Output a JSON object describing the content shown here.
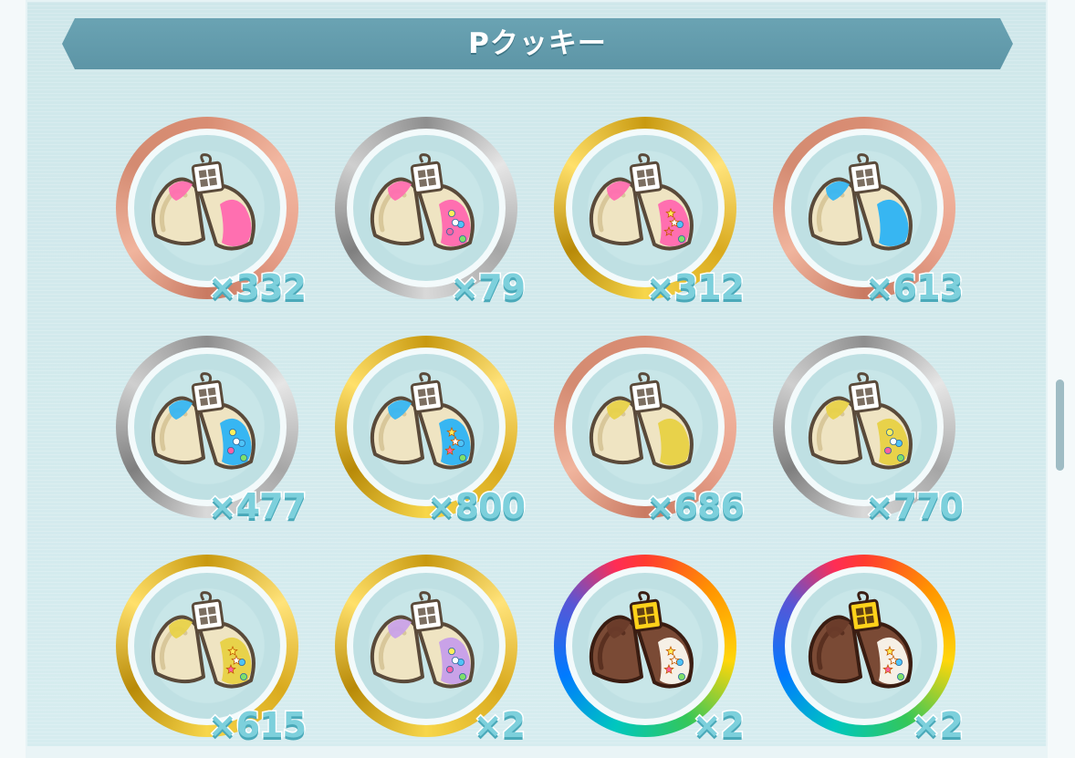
{
  "header": {
    "title": "Pクッキー"
  },
  "items": [
    {
      "count": "×332",
      "ring": "bronze",
      "cookie": "pink",
      "accent": "#ff6fb0"
    },
    {
      "count": "×79",
      "ring": "silver",
      "cookie": "pink-dots",
      "accent": "#ff6fb0"
    },
    {
      "count": "×312",
      "ring": "gold",
      "cookie": "pink-stars",
      "accent": "#ff6fb0"
    },
    {
      "count": "×613",
      "ring": "bronze",
      "cookie": "blue",
      "accent": "#37b6f2"
    },
    {
      "count": "×477",
      "ring": "silver",
      "cookie": "blue-dots",
      "accent": "#37b6f2"
    },
    {
      "count": "×800",
      "ring": "gold",
      "cookie": "blue-stars",
      "accent": "#37b6f2"
    },
    {
      "count": "×686",
      "ring": "bronze",
      "cookie": "yellow",
      "accent": "#e8d24a"
    },
    {
      "count": "×770",
      "ring": "silver",
      "cookie": "yellow-dots",
      "accent": "#e8d24a"
    },
    {
      "count": "×615",
      "ring": "gold",
      "cookie": "yellow-stars",
      "accent": "#e8d24a"
    },
    {
      "count": "×2",
      "ring": "gold",
      "cookie": "purple-dots",
      "accent": "#c9a2e8"
    },
    {
      "count": "×2",
      "ring": "rainbow",
      "cookie": "chocolate-stars",
      "accent": "#6a3b2a"
    },
    {
      "count": "×2",
      "ring": "rainbow",
      "cookie": "chocolate-stars",
      "accent": "#6a3b2a"
    }
  ],
  "colors": {
    "header_bg": "#6aa3b3",
    "count_fill": "#7dd0dc",
    "panel_bg": "#cfe7ea"
  },
  "icons": {
    "item": "fortune-cookie-icon"
  }
}
